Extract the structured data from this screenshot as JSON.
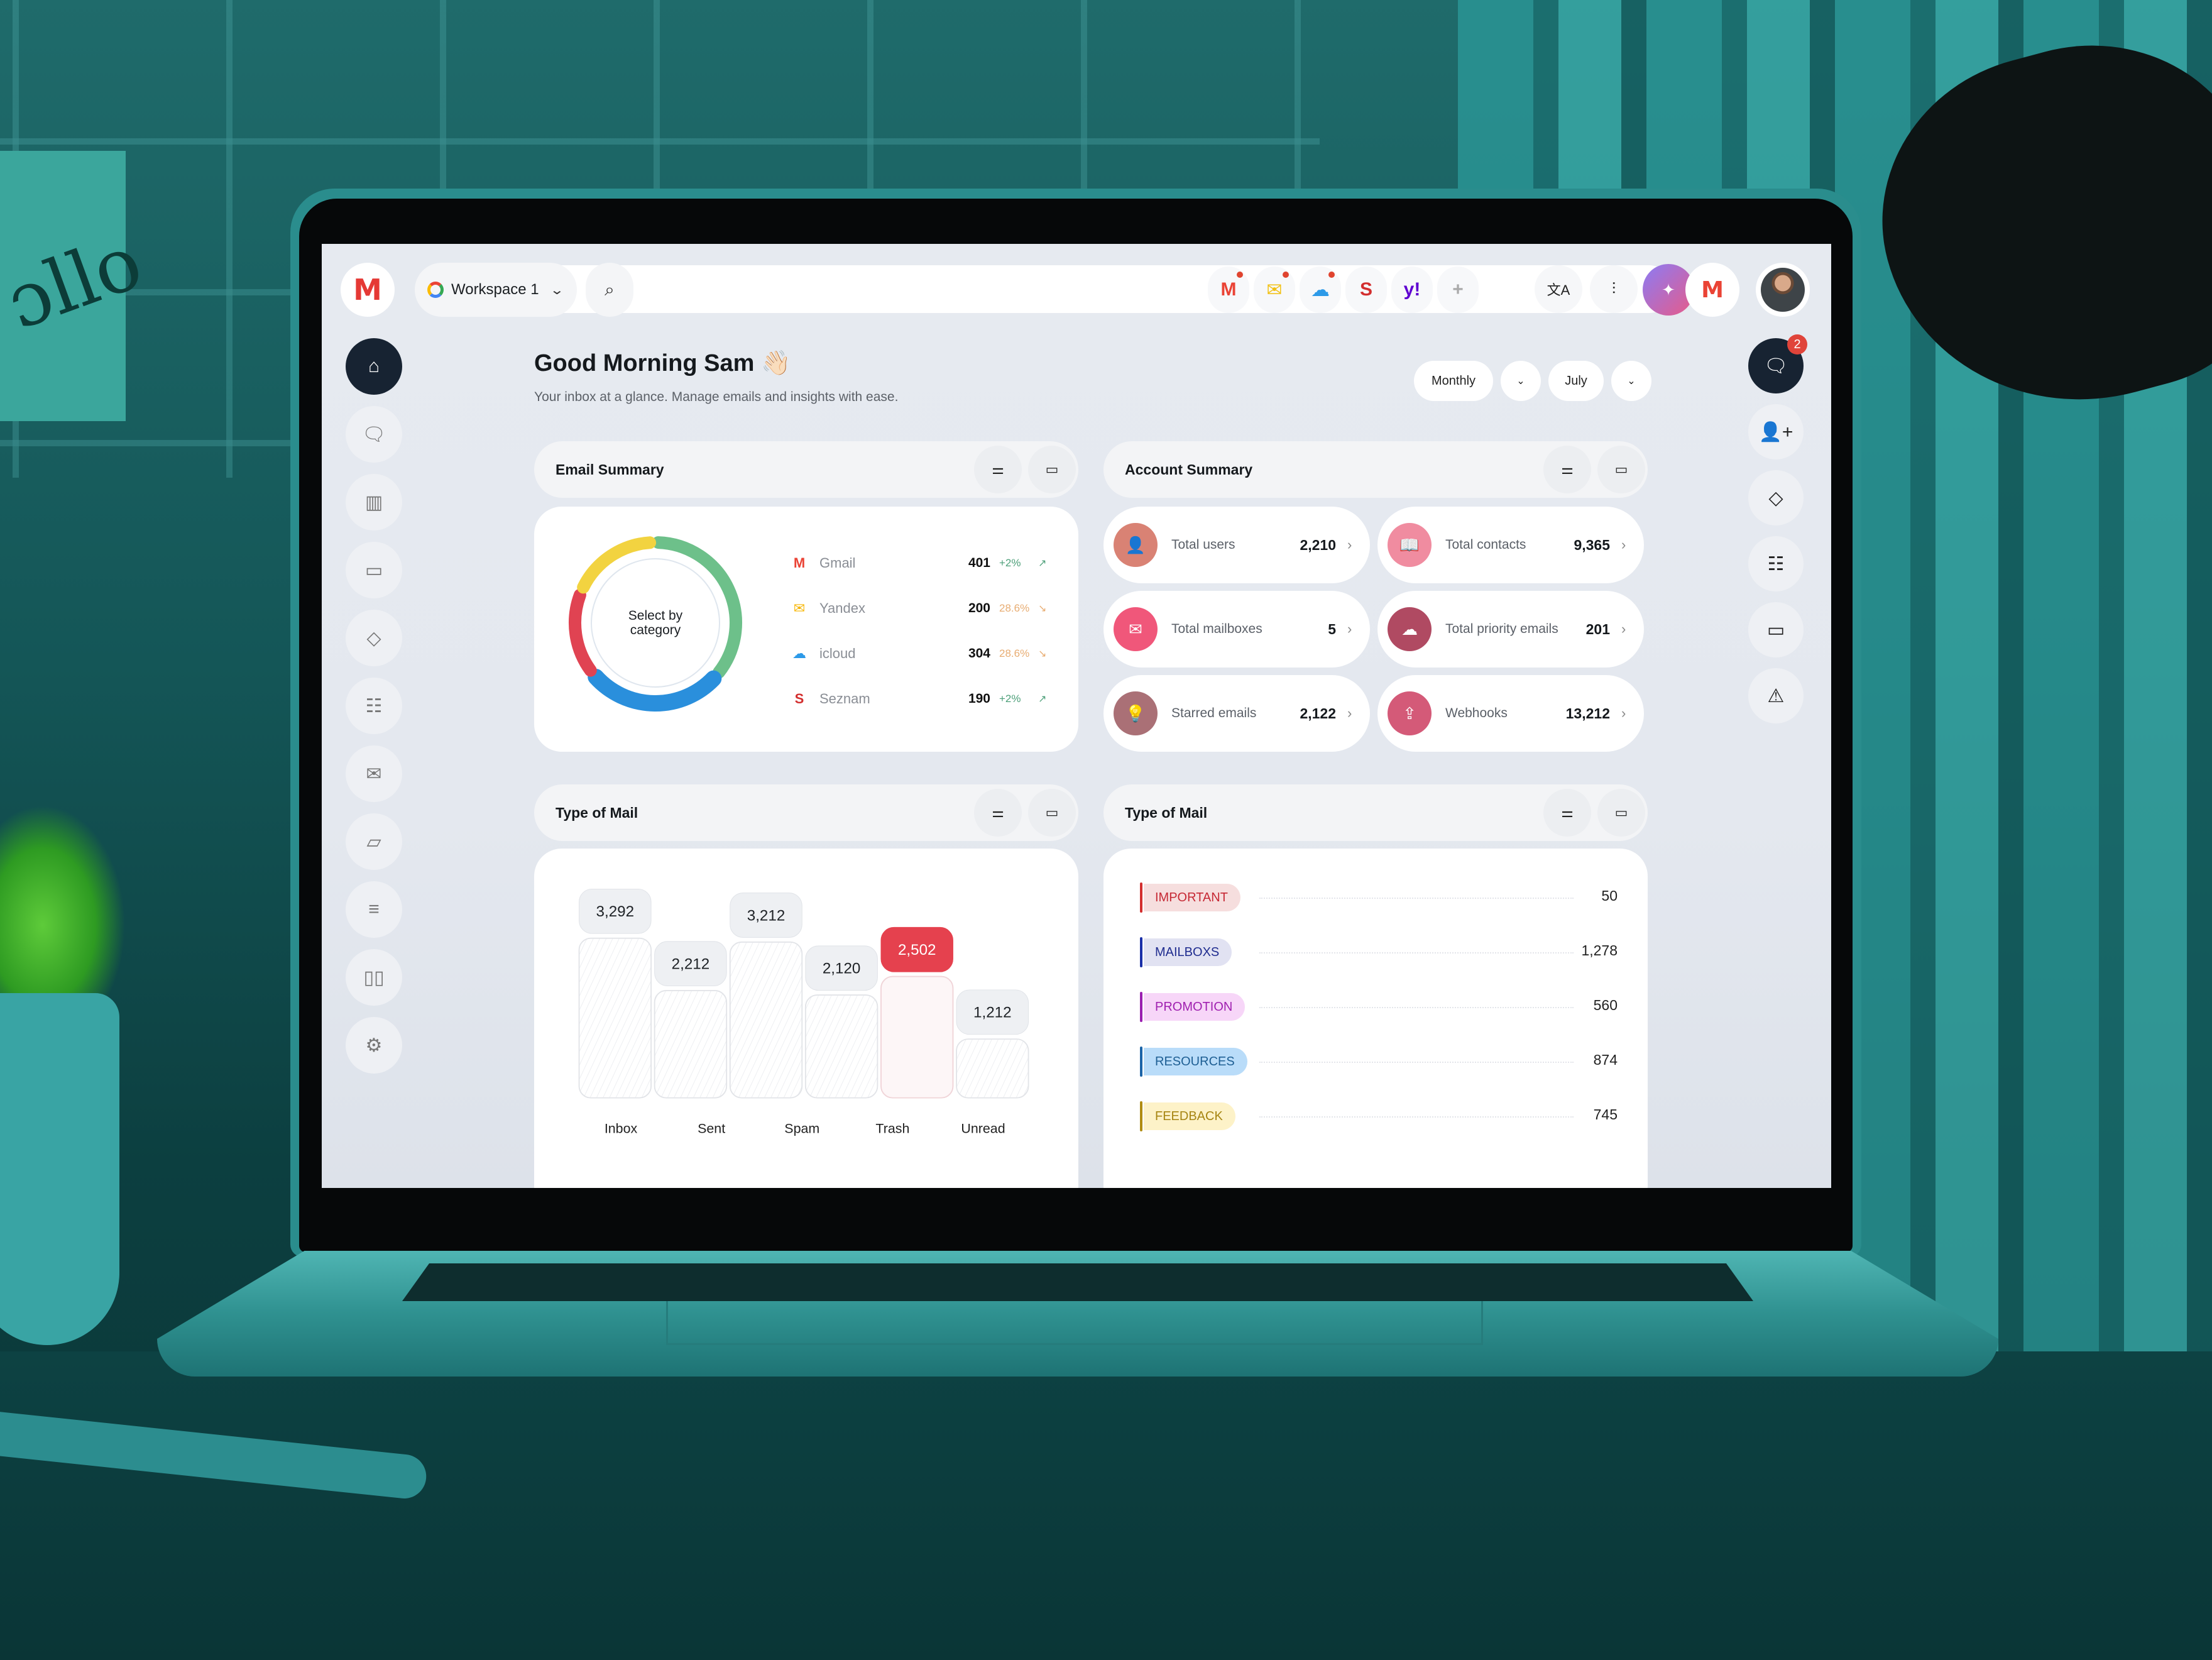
{
  "topbar": {
    "logo": "M",
    "workspace_label": "Workspace 1",
    "providers": [
      {
        "name": "gmail",
        "glyph": "M",
        "color": "#ea4335",
        "has_notification": true
      },
      {
        "name": "yandex",
        "glyph": "✉",
        "color": "#f2c011",
        "has_notification": true
      },
      {
        "name": "icloud",
        "glyph": "☁",
        "color": "#2d9ae8",
        "has_notification": true
      },
      {
        "name": "seznam",
        "glyph": "S",
        "color": "#d32f2f",
        "has_notification": false
      },
      {
        "name": "yahoo",
        "glyph": "y!",
        "color": "#5f01d1",
        "has_notification": false
      },
      {
        "name": "add-provider",
        "glyph": "+",
        "color": "#aaaaaa",
        "has_notification": false
      }
    ],
    "tools": {
      "translate": "文A",
      "sliders": "⫶",
      "magic": "✦"
    },
    "account_glyph": "M"
  },
  "left_nav": [
    {
      "name": "home",
      "glyph": "⌂",
      "active": true
    },
    {
      "name": "chats",
      "glyph": "🗨",
      "active": false
    },
    {
      "name": "analytics",
      "glyph": "▥",
      "active": false
    },
    {
      "name": "calendar",
      "glyph": "▭",
      "active": false
    },
    {
      "name": "tags",
      "glyph": "◇",
      "active": false
    },
    {
      "name": "contacts",
      "glyph": "☷",
      "active": false
    },
    {
      "name": "mail",
      "glyph": "✉",
      "active": false
    },
    {
      "name": "folder",
      "glyph": "▱",
      "active": false
    },
    {
      "name": "notes",
      "glyph": "≡",
      "active": false
    },
    {
      "name": "archive",
      "glyph": "▯▯",
      "active": false
    },
    {
      "name": "settings",
      "glyph": "⚙",
      "active": false
    }
  ],
  "right_nav": [
    {
      "name": "messages",
      "glyph": "🗨",
      "active": true,
      "badge": "2"
    },
    {
      "name": "add-user",
      "glyph": "👤+",
      "active": false,
      "badge": null
    },
    {
      "name": "tags",
      "glyph": "◇",
      "active": false,
      "badge": null
    },
    {
      "name": "contacts",
      "glyph": "☷",
      "active": false,
      "badge": null
    },
    {
      "name": "calendar",
      "glyph": "▭",
      "active": false,
      "badge": null
    },
    {
      "name": "alerts",
      "glyph": "⚠",
      "active": false,
      "badge": null
    }
  ],
  "header": {
    "greeting": "Good Morning Sam 👋🏻",
    "subtitle": "Your inbox at a glance. Manage emails and insights with ease.",
    "period": "Monthly",
    "month": "July"
  },
  "email_summary": {
    "title": "Email Summary",
    "center_label_line1": "Select by",
    "center_label_line2": "category",
    "providers": [
      {
        "name": "Gmail",
        "value": "401",
        "change": "+2%",
        "trend": "up",
        "icon_color": "#ea4335",
        "glyph": "M"
      },
      {
        "name": "Yandex",
        "value": "200",
        "change": "28.6%",
        "trend": "down",
        "icon_color": "#f7b500",
        "glyph": "✉"
      },
      {
        "name": "icloud",
        "value": "304",
        "change": "28.6%",
        "trend": "down",
        "icon_color": "#2d9ae8",
        "glyph": "☁"
      },
      {
        "name": "Seznam",
        "value": "190",
        "change": "+2%",
        "trend": "up",
        "icon_color": "#d32f2f",
        "glyph": "S"
      }
    ]
  },
  "account_summary": {
    "title": "Account Summary",
    "items": [
      {
        "label": "Total users",
        "value": "2,210",
        "color": "#d98274",
        "glyph": "👤"
      },
      {
        "label": "Total contacts",
        "value": "9,365",
        "color": "#f08ca0",
        "glyph": "📖"
      },
      {
        "label": "Total mailboxes",
        "value": "5",
        "color": "#f0577a",
        "glyph": "✉"
      },
      {
        "label": "Total priority emails",
        "value": "201",
        "color": "#b04a62",
        "glyph": "☁"
      },
      {
        "label": "Starred emails",
        "value": "2,122",
        "color": "#aa7076",
        "glyph": "💡"
      },
      {
        "label": "Webhooks",
        "value": "13,212",
        "color": "#d45a78",
        "glyph": "⇪"
      }
    ]
  },
  "type_of_mail_bars": {
    "title": "Type of Mail",
    "highlight_color": "#e5414e"
  },
  "type_of_mail_tags": {
    "title": "Type of Mail",
    "tags": [
      {
        "label": "IMPORTANT",
        "value": "50",
        "text_color": "#c62834",
        "bg": "#f6dede",
        "bar": "#d32f2f"
      },
      {
        "label": "MAILBOXS",
        "value": "1,278",
        "text_color": "#1f2c8f",
        "bg": "#e1e2f2",
        "bar": "#1a2fa8"
      },
      {
        "label": "PROMOTION",
        "value": "560",
        "text_color": "#a020b0",
        "bg": "#f7d6f8",
        "bar": "#9a1fb0"
      },
      {
        "label": "RESOURCES",
        "value": "874",
        "text_color": "#1e5f94",
        "bg": "#b9dcf9",
        "bar": "#1b64a8"
      },
      {
        "label": "FEEDBACK",
        "value": "745",
        "text_color": "#a68512",
        "bg": "#fdf2c8",
        "bar": "#b08c12"
      }
    ]
  },
  "chart_data": [
    {
      "type": "pie",
      "title": "Email Summary",
      "subtitle": "Select by category",
      "categories": [
        "Gmail",
        "Yandex",
        "icloud",
        "Seznam"
      ],
      "values": [
        401,
        200,
        304,
        190
      ],
      "colors": [
        "#6dc08a",
        "#f2d340",
        "#2a8fdc",
        "#e04352"
      ],
      "legend": "right"
    },
    {
      "type": "bar",
      "title": "Type of Mail",
      "categories": [
        "Inbox",
        "Sent",
        "Spam",
        "Trash",
        "Unread"
      ],
      "values": [
        3292,
        2212,
        3212,
        2120,
        2502,
        1212
      ],
      "value_labels": [
        "3,292",
        "2,212",
        "3,212",
        "2,120",
        "2,502",
        "1,212"
      ],
      "highlighted": [
        false,
        false,
        false,
        false,
        true,
        false
      ],
      "xlabel": "",
      "ylabel": "",
      "ylim": [
        0,
        3500
      ],
      "grid": false
    }
  ]
}
